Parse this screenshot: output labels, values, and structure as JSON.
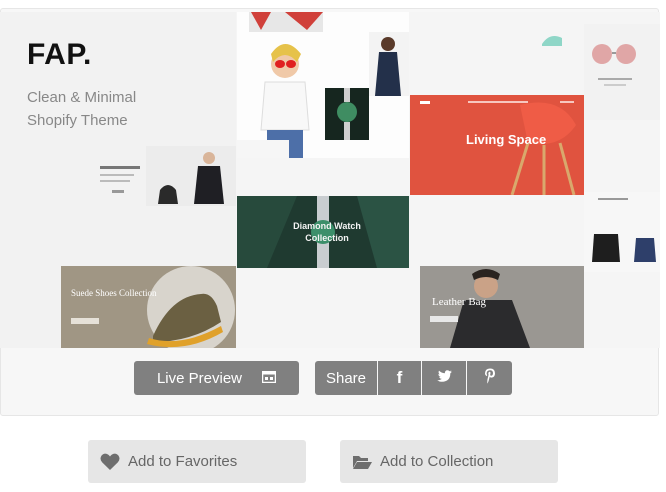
{
  "preview": {
    "brand": {
      "logo": "FAP.",
      "tagline": "Clean & Minimal Shopify Theme"
    },
    "tiles": {
      "living_space": "Living Space",
      "diamond_watch": "Diamond Watch Collection",
      "suede_shoes": "Suede Shoes Collection",
      "leather_bag": "Leather Bag"
    }
  },
  "buttons": {
    "live_preview": "Live Preview",
    "share": "Share",
    "facebook_icon": "f"
  },
  "actions": {
    "add_to_favorites": "Add to Favorites",
    "add_to_collection": "Add to Collection"
  },
  "colors": {
    "button_gray": "#808080",
    "action_bg": "#e6e6e6",
    "living_space_red": "#e0533f"
  }
}
